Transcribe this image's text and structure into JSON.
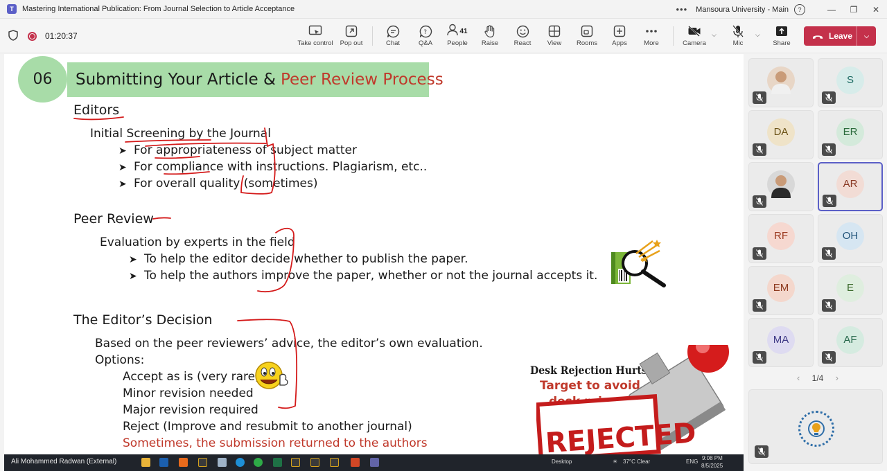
{
  "window": {
    "title": "Mastering International Publication: From Journal Selection to Article Acceptance",
    "org": "Mansoura University - Main"
  },
  "meeting": {
    "timer": "01:20:37",
    "people_count": "41",
    "tools": {
      "take_control": "Take control",
      "pop_out": "Pop out",
      "chat": "Chat",
      "qa": "Q&A",
      "people": "People",
      "raise": "Raise",
      "react": "React",
      "view": "View",
      "rooms": "Rooms",
      "apps": "Apps",
      "more": "More",
      "camera": "Camera",
      "mic": "Mic",
      "share": "Share",
      "leave": "Leave"
    }
  },
  "slide": {
    "number": "06",
    "title_black": "Submitting Your Article &",
    "title_red": "Peer Review Process",
    "editors_heading": "Editors",
    "screening": "Initial Screening by the Journal",
    "screening_items": [
      "For appropriateness of subject matter",
      "For compliance with instructions. Plagiarism, etc..",
      "For overall quality (sometimes)"
    ],
    "peer_heading": "Peer Review",
    "peer_eval": "Evaluation by experts in the field",
    "peer_items": [
      "To help the editor decide whether to publish the paper.",
      "To help the authors improve the paper, whether or not the journal accepts it."
    ],
    "decision_heading": "The Editor’s Decision",
    "decision_based": "Based on the peer reviewers’ advice, the editor’s own evaluation.",
    "options_label": "Options:",
    "options": [
      "Accept as is (very rare)",
      "Minor revision needed",
      "Major revision required",
      "Reject (Improve and resubmit to another journal)"
    ],
    "returned_note": "Sometimes, the submission returned to the authors",
    "desk_line1": "Desk Rejection Hurts.",
    "desk_line2": "Target to avoid",
    "desk_line3": "desk reject!",
    "stamp_text": "REJECTED"
  },
  "participants": [
    {
      "initials": "",
      "photo": true,
      "color": "#e8d6c6"
    },
    {
      "initials": "S",
      "color": "#d7ecea",
      "text_color": "#1c6b63"
    },
    {
      "initials": "DA",
      "color": "#efe3c8",
      "text_color": "#6b5216"
    },
    {
      "initials": "ER",
      "color": "#d4eadb",
      "text_color": "#2b6b3c"
    },
    {
      "initials": "",
      "photo": true,
      "color": "#d8d8d8"
    },
    {
      "initials": "AR",
      "color": "#f2dcd5",
      "text_color": "#8a3a25",
      "active": true
    },
    {
      "initials": "RF",
      "color": "#f6d8d0",
      "text_color": "#9c3b22"
    },
    {
      "initials": "OH",
      "color": "#d6e6f2",
      "text_color": "#22547a"
    },
    {
      "initials": "EM",
      "color": "#f4d7cc",
      "text_color": "#8e3a1e"
    },
    {
      "initials": "E",
      "color": "#dfeedf",
      "text_color": "#3d6b2e"
    },
    {
      "initials": "MA",
      "color": "#dedbf1",
      "text_color": "#3f3a86"
    },
    {
      "initials": "AF",
      "color": "#d5ebe0",
      "text_color": "#26684b"
    }
  ],
  "pager": {
    "label": "1/4"
  },
  "taskbar": {
    "presenter_name": "Ali Mohammed Radwan (External)",
    "desktop_label": "Desktop",
    "weather": "37°C  Clear",
    "lang": "ENG",
    "time": "9:08 PM",
    "date": "8/5/2025"
  }
}
